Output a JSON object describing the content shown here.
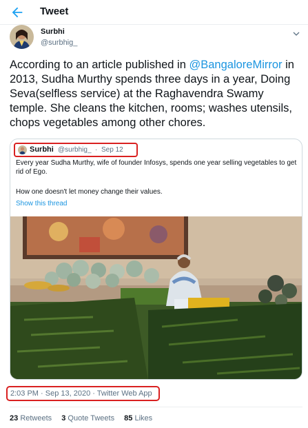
{
  "header": {
    "title": "Tweet",
    "back_icon": "arrow-left-icon"
  },
  "tweet": {
    "author": {
      "name": "Surbhi",
      "handle": "@surbhig_"
    },
    "text_before": "According to an article published in ",
    "mention": "@BangaloreMirror",
    "text_after": " in 2013, Sudha Murthy spends three days in a year, Doing Seva(selfless service) at the Raghavendra Swamy temple. She cleans the kitchen, rooms; washes utensils, chops vegetables among other chores.",
    "timestamp": "2:03 PM · Sep 13, 2020 · Twitter Web App"
  },
  "quoted": {
    "name": "Surbhi",
    "handle": "@surbhig_",
    "separator": "·",
    "date": "Sep 12",
    "text1": "Every year Sudha Murthy, wife of founder Infosys, spends one year selling vegetables to get rid of Ego.",
    "text2": "How one doesn't let money change their values.",
    "show_thread": "Show this thread"
  },
  "stats": {
    "retweets_count": "23",
    "retweets_label": "Retweets",
    "quotes_count": "3",
    "quotes_label": "Quote Tweets",
    "likes_count": "85",
    "likes_label": "Likes"
  },
  "colors": {
    "link": "#1b95e0",
    "highlight": "#d92020",
    "muted": "#5b7083"
  }
}
